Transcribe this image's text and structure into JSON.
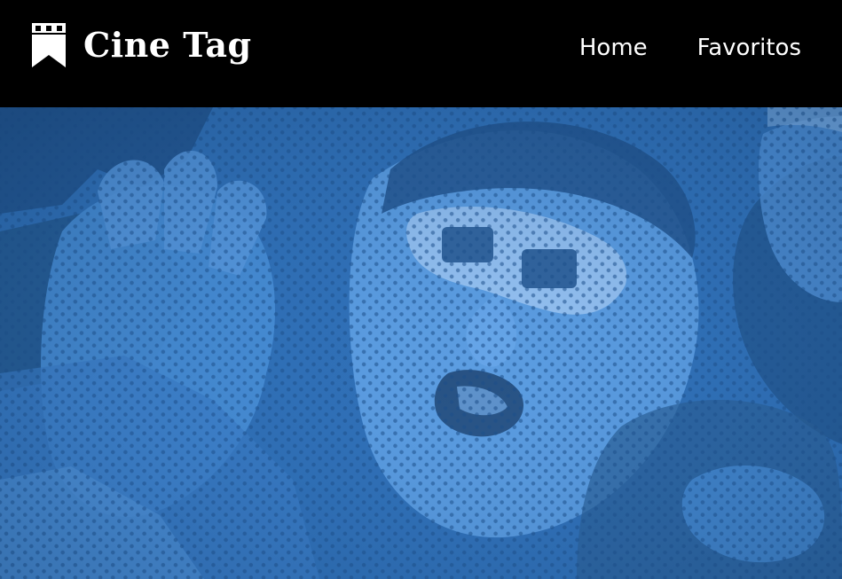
{
  "header": {
    "brand": {
      "name": "Cine Tag",
      "icon": "film-bookmark-icon"
    },
    "nav": [
      {
        "label": "Home"
      },
      {
        "label": "Favoritos"
      }
    ]
  },
  "hero": {
    "image": "halftone-photo-audience-3d-glasses",
    "tint_color": "#2f6fb6"
  },
  "colors": {
    "header_bg": "#000000",
    "header_text": "#ffffff",
    "hero_blue": "#2f6fb6",
    "hero_dark": "#173a63",
    "hero_light": "#5a9ae0"
  }
}
